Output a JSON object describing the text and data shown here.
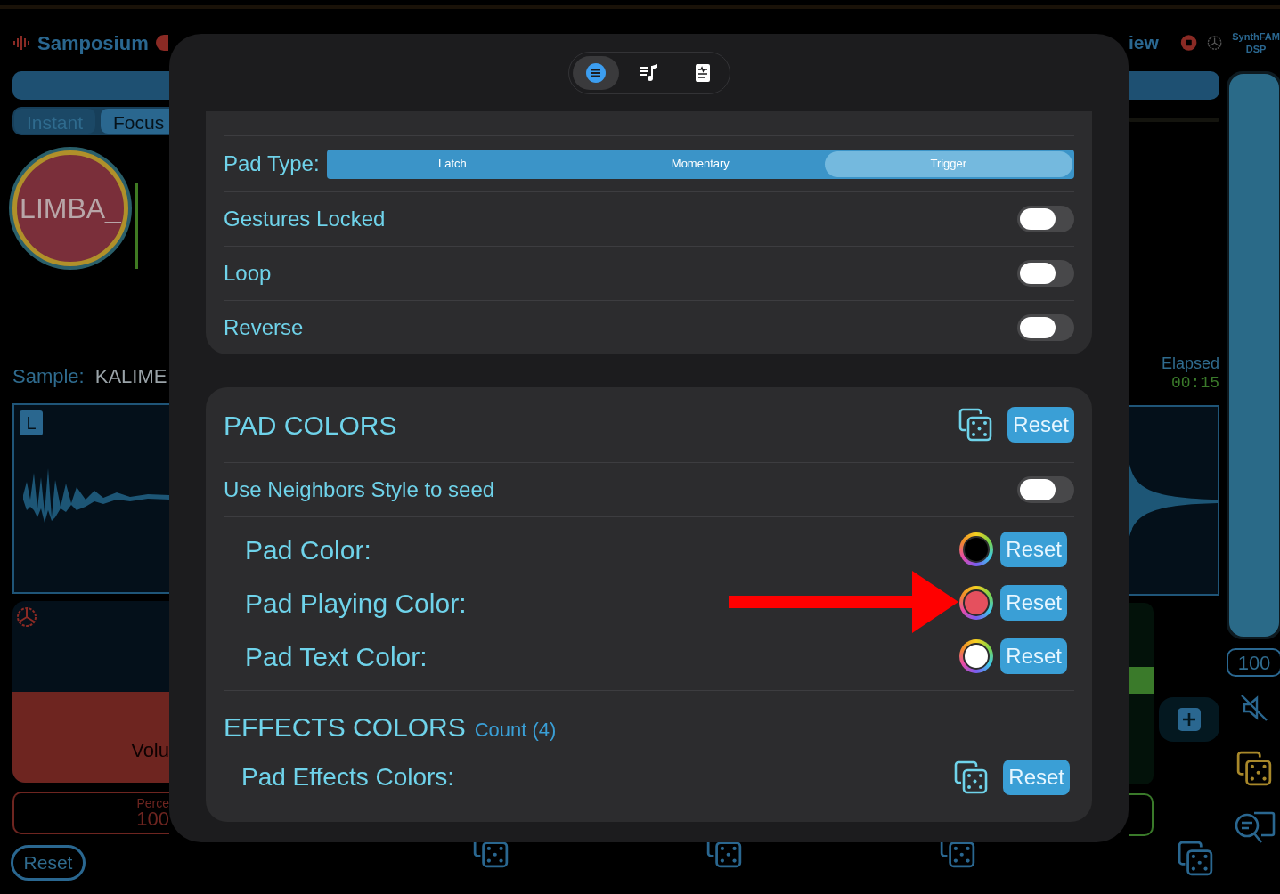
{
  "background_app": {
    "header": {
      "title": "Samposium",
      "view_label": "iew",
      "brand_line_1": "SynthFAM",
      "brand_line_2": "DSP"
    },
    "mode_tabs": [
      {
        "label": "Instant",
        "selected": false
      },
      {
        "label": "Focus",
        "selected": true
      }
    ],
    "pad": {
      "label": "LIMBA_"
    },
    "sample": {
      "label": "Sample:",
      "value": "KALIME"
    },
    "channel_badge": "L",
    "volume": {
      "label": "Volu",
      "level": 0.5
    },
    "percent": {
      "label": "Perce",
      "value": "100"
    },
    "reset_button": "Reset",
    "elapsed": {
      "label": "Elapsed",
      "value": "00:15"
    },
    "master": {
      "level": 1,
      "value": "100"
    }
  },
  "sheet": {
    "tabs": [
      {
        "kind": "list",
        "selected": true
      },
      {
        "kind": "music",
        "selected": false
      },
      {
        "kind": "document",
        "selected": false
      }
    ],
    "play_pad_rows": [
      {
        "kind": "segmented",
        "label": "Pad Type:",
        "options": [
          {
            "label": "Latch",
            "selected": false
          },
          {
            "label": "Momentary",
            "selected": false
          },
          {
            "label": "Trigger",
            "selected": true
          }
        ]
      },
      {
        "kind": "toggle",
        "label": "Gestures Locked",
        "on": false
      },
      {
        "kind": "toggle",
        "label": "Loop",
        "on": false
      },
      {
        "kind": "toggle",
        "label": "Reverse",
        "on": false
      }
    ],
    "pad_colors": {
      "title": "PAD COLORS",
      "reset": "Reset",
      "neighbors": {
        "label": "Use Neighbors Style to seed",
        "on": false
      },
      "colors": [
        {
          "label": "Pad Color:",
          "color": "#000000",
          "reset": "Reset"
        },
        {
          "label": "Pad Playing Color:",
          "color": "#e5505e",
          "reset": "Reset"
        },
        {
          "label": "Pad Text Color:",
          "color": "#ffffff",
          "reset": "Reset"
        }
      ]
    },
    "effects_colors": {
      "title": "EFFECTS COLORS",
      "count": "Count (4)",
      "rows": [
        {
          "label": "Pad Effects Colors:",
          "reset": "Reset"
        }
      ]
    }
  }
}
